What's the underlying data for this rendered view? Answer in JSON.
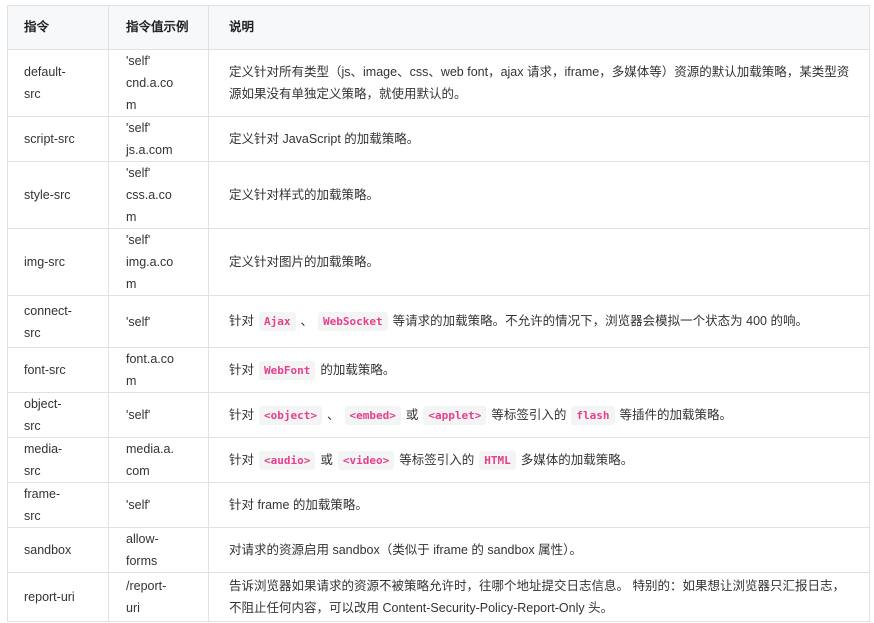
{
  "headers": [
    "指令",
    "指令值示例",
    "说明"
  ],
  "rows": [
    {
      "name": [
        "default-",
        "src"
      ],
      "value": [
        "'self'",
        "cnd.a.co",
        "m"
      ],
      "desc": [
        [
          "t",
          "定义针对所有类型（js、image、css、web font，ajax 请求，iframe，多媒体等）资源的默认加载策略，某类型资源如果没有单独定义策略，就使用默认的。"
        ]
      ]
    },
    {
      "name": [
        "script-src"
      ],
      "value": [
        "'self'",
        "js.a.com"
      ],
      "desc": [
        [
          "t",
          "定义针对 JavaScript 的加载策略。"
        ]
      ]
    },
    {
      "name": [
        "style-src"
      ],
      "value": [
        "'self'",
        "css.a.co",
        "m"
      ],
      "desc": [
        [
          "t",
          "定义针对样式的加载策略。"
        ]
      ]
    },
    {
      "name": [
        "img-src"
      ],
      "value": [
        "'self'",
        "img.a.co",
        "m"
      ],
      "desc": [
        [
          "t",
          "定义针对图片的加载策略。"
        ]
      ]
    },
    {
      "name": [
        "connect-",
        "src"
      ],
      "value": [
        "'self'"
      ],
      "desc": [
        [
          "t",
          "针对"
        ],
        [
          "c",
          "Ajax"
        ],
        [
          "t",
          "、"
        ],
        [
          "c",
          "WebSocket"
        ],
        [
          "t",
          "等请求的加载策略。不允许的情况下，浏览器会模拟一个状态为 400 的响。"
        ]
      ]
    },
    {
      "name": [
        "font-src"
      ],
      "value": [
        "font.a.co",
        "m"
      ],
      "desc": [
        [
          "t",
          "针对"
        ],
        [
          "c",
          "WebFont"
        ],
        [
          "t",
          "的加载策略。"
        ]
      ]
    },
    {
      "name": [
        "object-",
        "src"
      ],
      "value": [
        "'self'"
      ],
      "desc": [
        [
          "t",
          "针对"
        ],
        [
          "c",
          "<object>"
        ],
        [
          "t",
          "、"
        ],
        [
          "c",
          "<embed>"
        ],
        [
          "t",
          "或"
        ],
        [
          "c",
          "<applet>"
        ],
        [
          "t",
          "等标签引入的"
        ],
        [
          "c",
          "flash"
        ],
        [
          "t",
          "等插件的加载策略。"
        ]
      ]
    },
    {
      "name": [
        "media-",
        "src"
      ],
      "value": [
        "media.a.",
        "com"
      ],
      "desc": [
        [
          "t",
          "针对"
        ],
        [
          "c",
          "<audio>"
        ],
        [
          "t",
          "或"
        ],
        [
          "c",
          "<video>"
        ],
        [
          "t",
          "等标签引入的"
        ],
        [
          "c",
          "HTML"
        ],
        [
          "t",
          "多媒体的加载策略。"
        ]
      ]
    },
    {
      "name": [
        "frame-",
        "src"
      ],
      "value": [
        "'self'"
      ],
      "desc": [
        [
          "t",
          "针对 frame 的加载策略。"
        ]
      ]
    },
    {
      "name": [
        "sandbox"
      ],
      "value": [
        "allow-",
        "forms"
      ],
      "desc": [
        [
          "t",
          "对请求的资源启用 sandbox（类似于 iframe 的 sandbox 属性）。"
        ]
      ]
    },
    {
      "name": [
        "report-uri"
      ],
      "value": [
        "/report-",
        "uri"
      ],
      "desc": [
        [
          "t",
          "告诉浏览器如果请求的资源不被策略允许时，往哪个地址提交日志信息。 特别的：如果想让浏览器只汇报日志，不阻止任何内容，可以改用 Content-Security-Policy-Report-Only 头。"
        ]
      ]
    }
  ]
}
